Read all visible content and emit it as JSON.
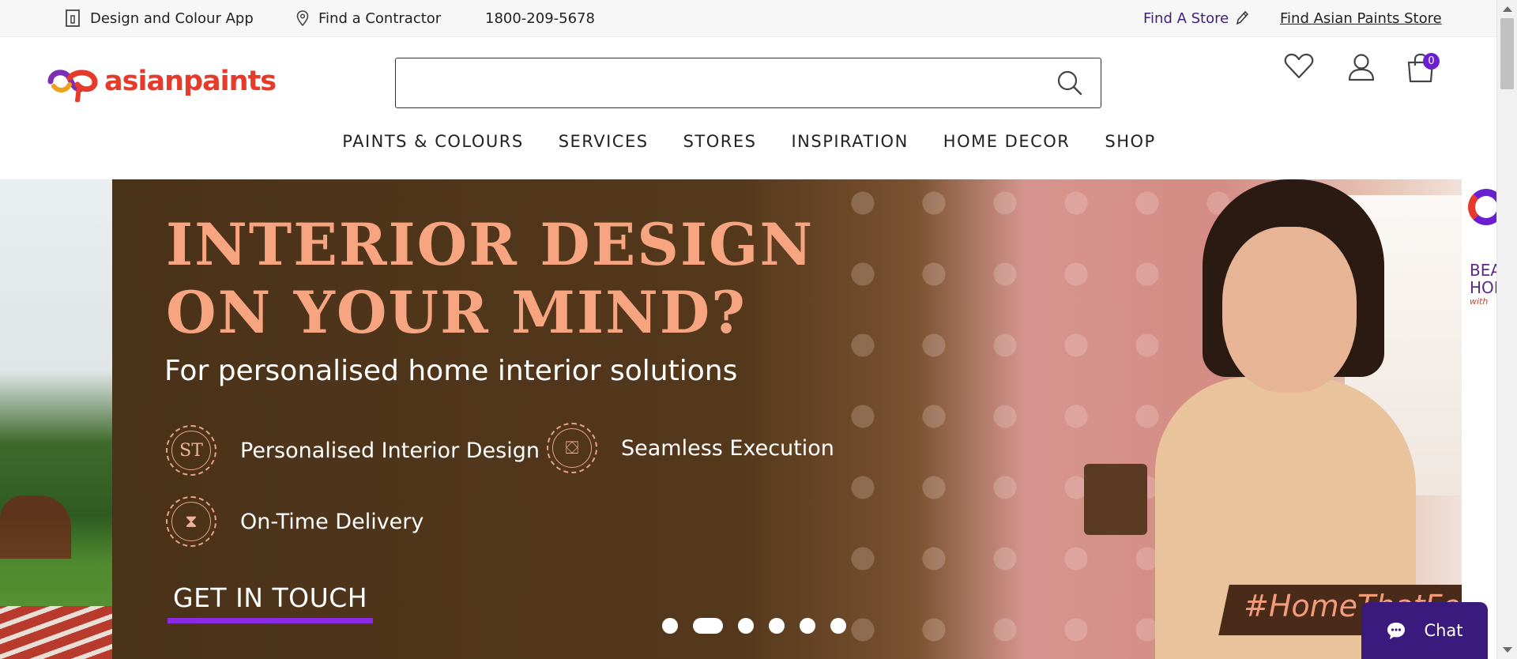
{
  "topbar": {
    "app_label": "Design and Colour App",
    "contractor_label": "Find a Contractor",
    "phone": "1800-209-5678",
    "find_store_label": "Find A Store",
    "asian_store_label": "Find Asian Paints Store"
  },
  "header": {
    "logo_text": "asianpaints",
    "search_placeholder": "",
    "cart_count": "0",
    "icons": [
      "wishlist-heart-icon",
      "user-account-icon",
      "shopping-bag-icon"
    ]
  },
  "nav": {
    "items": [
      "PAINTS & COLOURS",
      "SERVICES",
      "STORES",
      "INSPIRATION",
      "HOME DECOR",
      "SHOP"
    ]
  },
  "hero": {
    "headline_line1": "INTERIOR DESIGN",
    "headline_line2": "ON YOUR MIND?",
    "subhead": "For personalised home interior solutions",
    "features": [
      {
        "label": "Personalised Interior Design",
        "icon": "monogram-icon"
      },
      {
        "label": "Seamless Execution",
        "icon": "sofa-icon"
      },
      {
        "label": "On-Time Delivery",
        "icon": "hourglass-icon"
      }
    ],
    "cta": "GET IN TOUCH",
    "hashtag": "#HomeThatFeels",
    "right_peek_text1": "BEA",
    "right_peek_text2": "HOI",
    "right_peek_text3": "with",
    "carousel_dots": 6,
    "active_dot": 2
  },
  "chat": {
    "label": "Chat"
  },
  "colors": {
    "brand_red": "#e63a2a",
    "brand_purple": "#6a1fd1",
    "headline_peach": "#f7a481",
    "chat_bg": "#3b1a7d"
  }
}
